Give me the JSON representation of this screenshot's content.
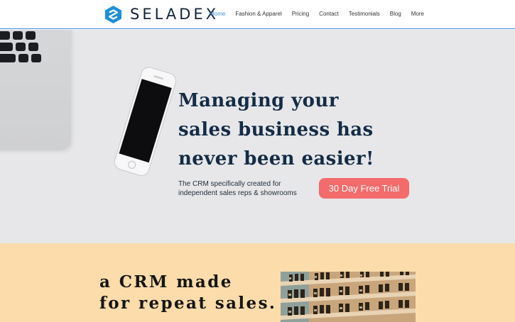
{
  "brand": {
    "name": "SELADEX",
    "mark_color": "#1e8fd6"
  },
  "nav": {
    "items": [
      {
        "label": "Home",
        "active": true
      },
      {
        "label": "Fashion & Apparel",
        "active": false
      },
      {
        "label": "Pricing",
        "active": false
      },
      {
        "label": "Contact",
        "active": false
      },
      {
        "label": "Testimonials",
        "active": false
      },
      {
        "label": "Blog",
        "active": false
      },
      {
        "label": "More",
        "active": false
      }
    ],
    "active_color": "#3f8fd8"
  },
  "hero": {
    "title_line1": "Managing your",
    "title_line2": "sales business has",
    "title_line3": "never been easier!",
    "subtitle_line1": "The CRM specifically created for",
    "subtitle_line2": "independent sales reps & showrooms",
    "cta_label": "30 Day Free Trial",
    "cta_color": "#f36b6b",
    "background": "#e7e7e9"
  },
  "section2": {
    "title_line1": "a CRM made",
    "title_line2": "for repeat sales.",
    "background": "#fcdcaa"
  },
  "icons": [
    "seladex-logo-icon",
    "laptop-image",
    "phone-image",
    "shelf-photo"
  ]
}
